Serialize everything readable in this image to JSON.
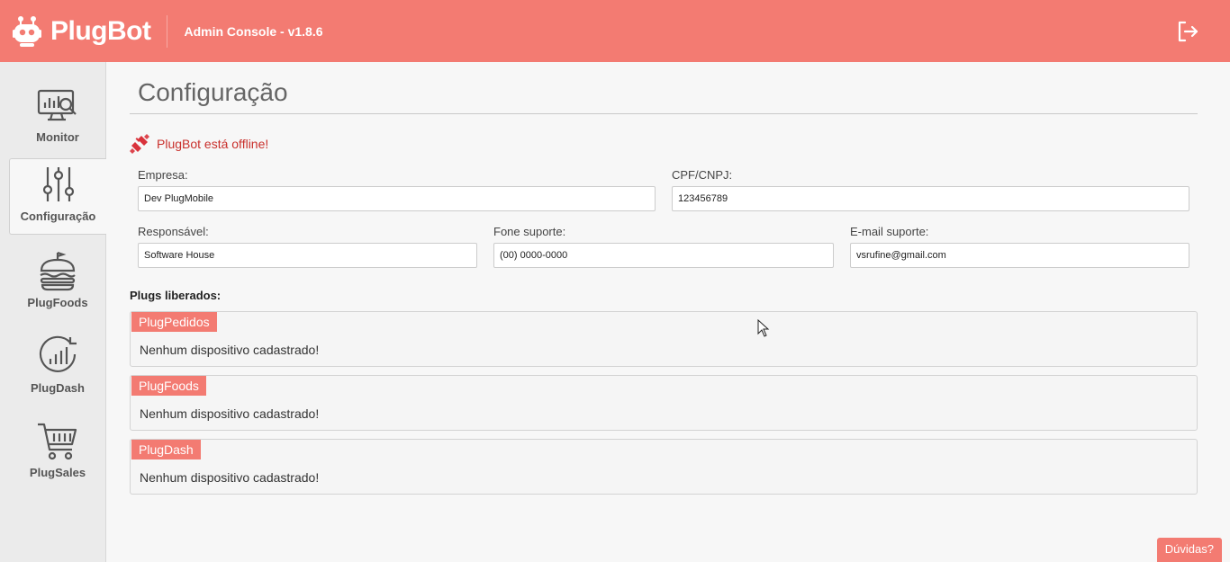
{
  "header": {
    "brand": "PlugBot",
    "console_title": "Admin Console - v1.8.6",
    "icons": {
      "logo": "robot-icon",
      "logout": "logout-icon"
    }
  },
  "sidebar": {
    "items": [
      {
        "label": "Monitor",
        "icon": "monitor-chart-icon",
        "active": false
      },
      {
        "label": "Configuração",
        "icon": "sliders-icon",
        "active": true
      },
      {
        "label": "PlugFoods",
        "icon": "burger-icon",
        "active": false
      },
      {
        "label": "PlugDash",
        "icon": "bar-chart-circle-icon",
        "active": false
      },
      {
        "label": "PlugSales",
        "icon": "cart-icon",
        "active": false
      }
    ]
  },
  "page": {
    "title": "Configuração",
    "status_text": "PlugBot está offline!",
    "form": {
      "empresa": {
        "label": "Empresa:",
        "value": "Dev PlugMobile"
      },
      "cpf_cnpj": {
        "label": "CPF/CNPJ:",
        "value": "123456789"
      },
      "responsavel": {
        "label": "Responsável:",
        "value": "Software House"
      },
      "fone": {
        "label": "Fone suporte:",
        "value": "(00) 0000-0000"
      },
      "email": {
        "label": "E-mail suporte:",
        "value": "vsrufine@gmail.com"
      }
    },
    "plugs_title": "Plugs liberados:",
    "plugs": [
      {
        "name": "PlugPedidos",
        "message": "Nenhum dispositivo cadastrado!"
      },
      {
        "name": "PlugFoods",
        "message": "Nenhum dispositivo cadastrado!"
      },
      {
        "name": "PlugDash",
        "message": "Nenhum dispositivo cadastrado!"
      }
    ]
  },
  "help_label": "Dúvidas?",
  "colors": {
    "accent": "#f37b72",
    "offline": "#c9302c",
    "sidebar_bg": "#ebebeb",
    "page_bg": "#f7f7f7"
  }
}
